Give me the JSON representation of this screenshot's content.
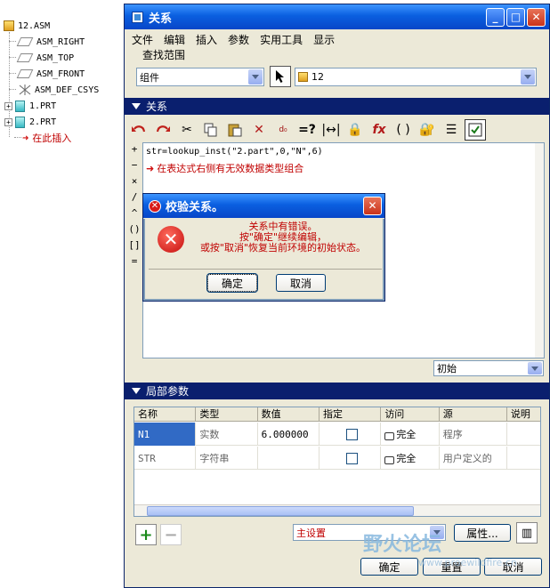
{
  "tree": {
    "root": "12.ASM",
    "items": [
      "ASM_RIGHT",
      "ASM_TOP",
      "ASM_FRONT",
      "ASM_DEF_CSYS",
      "1.PRT",
      "2.PRT",
      "在此插入"
    ]
  },
  "window": {
    "title": "关系",
    "menu": [
      "文件",
      "编辑",
      "插入",
      "参数",
      "实用工具",
      "显示"
    ],
    "lookin_label": "查找范围",
    "scope_select": "组件",
    "model_select": "12",
    "relations_header": "关系",
    "side_ops": [
      "+",
      "−",
      "×",
      "/",
      "^",
      "()",
      "[]",
      "="
    ],
    "code_line": "str=lookup_inst(\"2.part\",0,\"N\",6)",
    "error_line": "在表达式右侧有无效数据类型组合",
    "sort_select": "初始",
    "local_params_header": "局部参数",
    "columns": [
      "名称",
      "类型",
      "数值",
      "指定",
      "访问",
      "源",
      "说明"
    ],
    "rows": [
      {
        "name": "N1",
        "type": "实数",
        "value": "6.000000",
        "access": "完全",
        "source": "程序"
      },
      {
        "name": "STR",
        "type": "字符串",
        "value": "",
        "access": "完全",
        "source": "用户定义的"
      }
    ],
    "main_setting": "主设置",
    "properties_button": "属性...",
    "ok_button": "确定",
    "reset_button": "重置",
    "cancel_button": "取消"
  },
  "dialog": {
    "title": "校验关系。",
    "line1": "关系中有错误。",
    "line2": "按\"确定\"继续编辑，",
    "line3": "或按\"取消\"恢复当前环境的初始状态。",
    "ok": "确定",
    "cancel": "取消"
  },
  "watermark": {
    "text": "野火论坛",
    "url": "www.proewildfire.cn"
  },
  "colors": {
    "title_blue": "#0a5fe0",
    "section_navy": "#0a1f6e",
    "error_red": "#c00000",
    "selection": "#316ac5"
  }
}
